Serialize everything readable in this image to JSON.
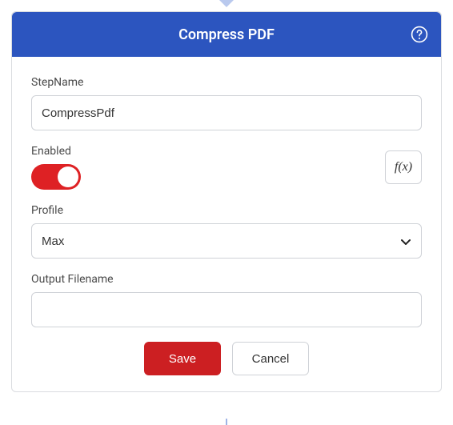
{
  "header": {
    "title": "Compress PDF"
  },
  "fields": {
    "stepName": {
      "label": "StepName",
      "value": "CompressPdf"
    },
    "enabled": {
      "label": "Enabled",
      "value": true
    },
    "fx": {
      "label": "f(x)"
    },
    "profile": {
      "label": "Profile",
      "value": "Max"
    },
    "outputFilename": {
      "label": "Output Filename",
      "value": ""
    }
  },
  "actions": {
    "save": "Save",
    "cancel": "Cancel"
  }
}
